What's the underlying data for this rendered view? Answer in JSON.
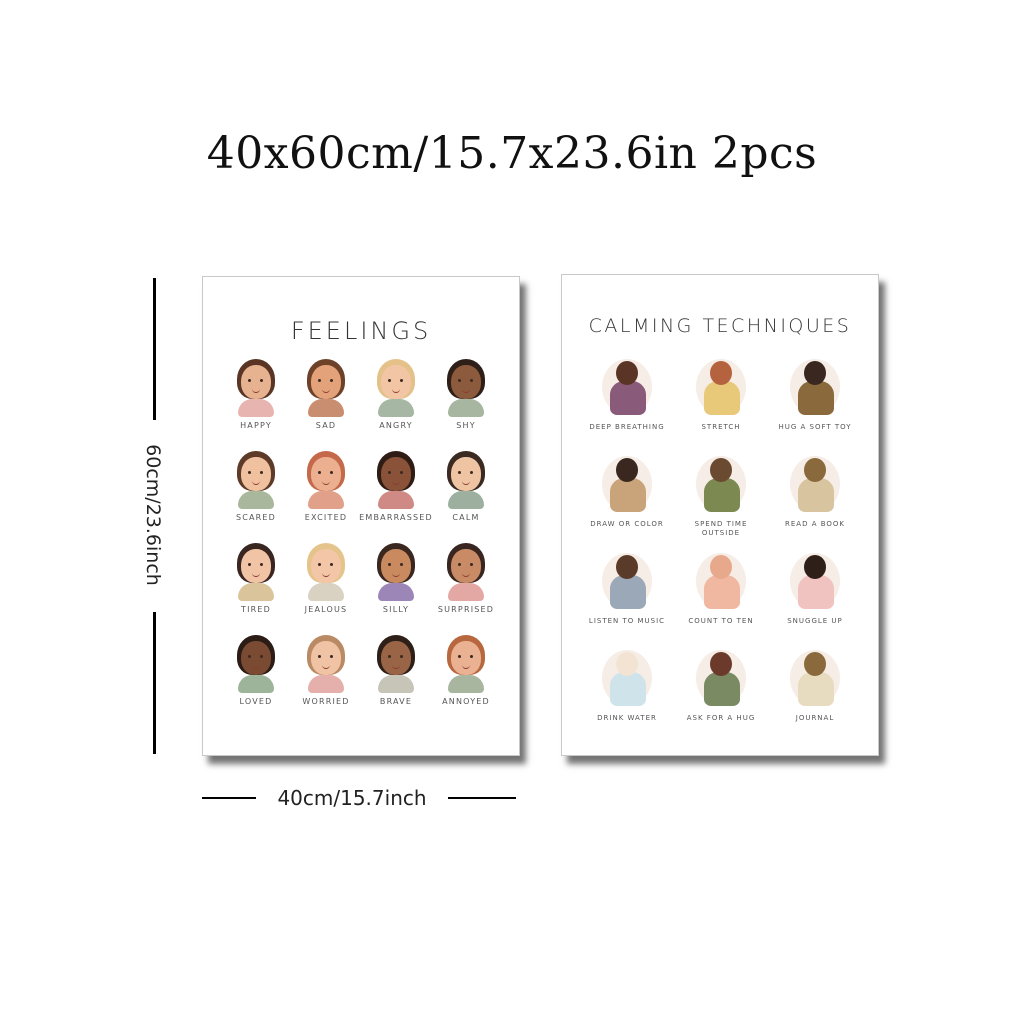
{
  "headline": "40x60cm/15.7x23.6in 2pcs",
  "dimensions": {
    "height_label": "60cm/23.6inch",
    "width_label": "40cm/15.7inch"
  },
  "feelings_poster": {
    "title": "FEELINGS",
    "items": [
      {
        "label": "HAPPY",
        "skin": "#e7b28f",
        "hair": "#5a3526",
        "shirt": "#e8b4b0"
      },
      {
        "label": "SAD",
        "skin": "#e3a27a",
        "hair": "#6e4228",
        "shirt": "#c98e6f"
      },
      {
        "label": "ANGRY",
        "skin": "#f2c6a4",
        "hair": "#e3c189",
        "shirt": "#a6b8a3"
      },
      {
        "label": "SHY",
        "skin": "#8c5a3c",
        "hair": "#2e1f18",
        "shirt": "#a7b6a1"
      },
      {
        "label": "SCARED",
        "skin": "#f0c19f",
        "hair": "#5e3a28",
        "shirt": "#a9b79c"
      },
      {
        "label": "EXCITED",
        "skin": "#ecb091",
        "hair": "#c46a4a",
        "shirt": "#e1a08a"
      },
      {
        "label": "EMBARRASSED",
        "skin": "#8a5238",
        "hair": "#2e1c15",
        "shirt": "#d08a86"
      },
      {
        "label": "CALM",
        "skin": "#efc4a3",
        "hair": "#3a2a22",
        "shirt": "#9db0a0"
      },
      {
        "label": "TIRED",
        "skin": "#f0c4a4",
        "hair": "#3a2620",
        "shirt": "#d9c49c"
      },
      {
        "label": "JEALOUS",
        "skin": "#f2c6a6",
        "hair": "#e5c48c",
        "shirt": "#d9d2c2"
      },
      {
        "label": "SILLY",
        "skin": "#c98a60",
        "hair": "#3a2720",
        "shirt": "#9c86b8"
      },
      {
        "label": "SURPRISED",
        "skin": "#c88b66",
        "hair": "#3a2620",
        "shirt": "#e4a8a4"
      },
      {
        "label": "LOVED",
        "skin": "#7a4a32",
        "hair": "#2b1c15",
        "shirt": "#9db49a"
      },
      {
        "label": "WORRIED",
        "skin": "#f1c3a5",
        "hair": "#b98a63",
        "shirt": "#e5b0ab"
      },
      {
        "label": "BRAVE",
        "skin": "#9a6446",
        "hair": "#2e1f18",
        "shirt": "#c7c5b8"
      },
      {
        "label": "ANNOYED",
        "skin": "#eab193",
        "hair": "#b8683f",
        "shirt": "#a8b6a0"
      }
    ]
  },
  "calming_poster": {
    "title": "CALMING TECHNIQUES",
    "items": [
      {
        "label": "DEEP BREATHING",
        "main": "#8a5a7a",
        "accent": "#5a3526"
      },
      {
        "label": "STRETCH",
        "main": "#e8c97a",
        "accent": "#b5633e"
      },
      {
        "label": "HUG A SOFT TOY",
        "main": "#8a6a3c",
        "accent": "#3a2720"
      },
      {
        "label": "DRAW OR COLOR",
        "main": "#c9a47a",
        "accent": "#3a2720"
      },
      {
        "label": "SPEND TIME OUTSIDE",
        "main": "#7c8a52",
        "accent": "#6b4a32"
      },
      {
        "label": "READ A BOOK",
        "main": "#d9c4a0",
        "accent": "#8a6a3c"
      },
      {
        "label": "LISTEN TO MUSIC",
        "main": "#9aa8b8",
        "accent": "#5a3a28"
      },
      {
        "label": "COUNT TO TEN",
        "main": "#f0b8a0",
        "accent": "#e8a88c"
      },
      {
        "label": "SNUGGLE UP",
        "main": "#f0c2c0",
        "accent": "#2e1f18"
      },
      {
        "label": "DRINK WATER",
        "main": "#cfe3ea",
        "accent": "#f3e3d3"
      },
      {
        "label": "ASK FOR A HUG",
        "main": "#7a8a62",
        "accent": "#6b3a2a"
      },
      {
        "label": "JOURNAL",
        "main": "#e8dcc0",
        "accent": "#8a6a3c"
      }
    ]
  }
}
